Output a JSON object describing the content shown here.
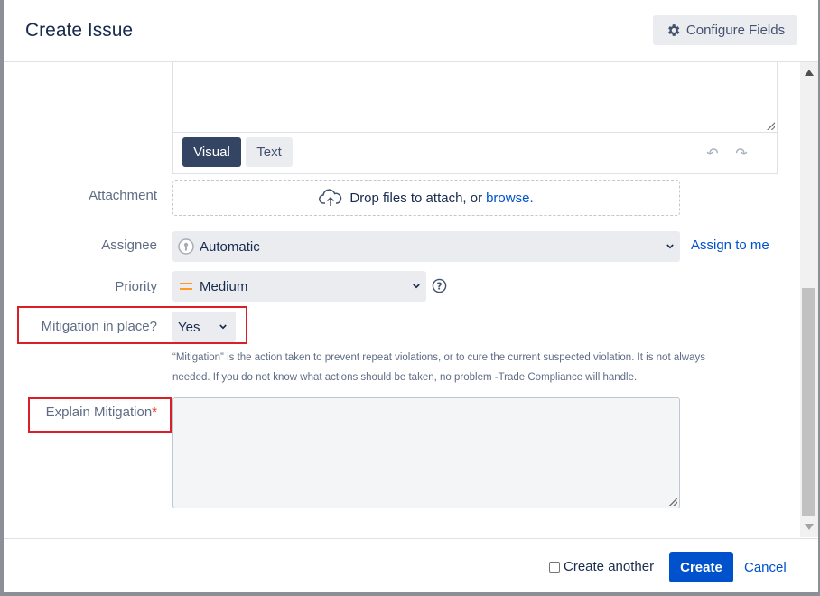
{
  "dialog": {
    "title": "Create Issue",
    "configure_fields_label": "Configure Fields"
  },
  "editor": {
    "visual_label": "Visual",
    "text_label": "Text",
    "undo_icon": "undo-icon",
    "redo_icon": "redo-icon"
  },
  "fields": {
    "attachment": {
      "label": "Attachment",
      "drop_text": "Drop files to attach, or",
      "browse_label": "browse."
    },
    "assignee": {
      "label": "Assignee",
      "value": "Automatic",
      "assign_to_me_label": "Assign to me"
    },
    "priority": {
      "label": "Priority",
      "value": "Medium",
      "priority_color": "#ff991f"
    },
    "mitigation": {
      "label": "Mitigation in place?",
      "value": "Yes",
      "description_line1": "“Mitigation” is the action taken to prevent repeat violations, or to cure the current suspected violation. It is not always",
      "description_line2": "needed. If you do not know what actions should be taken, no problem -Trade Compliance will handle."
    },
    "explain_mitigation": {
      "label": "Explain Mitigation",
      "required_marker": "*",
      "value": ""
    }
  },
  "footer": {
    "create_another_label": "Create another",
    "create_another_checked": false,
    "create_label": "Create",
    "cancel_label": "Cancel"
  },
  "colors": {
    "primary": "#0052cc",
    "highlight_border": "#d92029",
    "visual_button": "#344563"
  }
}
